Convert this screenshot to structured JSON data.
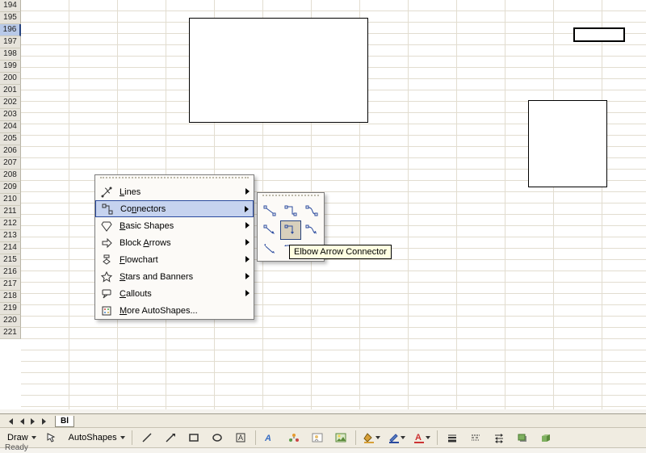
{
  "rows": [
    "194",
    "195",
    "196",
    "197",
    "198",
    "199",
    "200",
    "201",
    "202",
    "203",
    "204",
    "205",
    "206",
    "207",
    "208",
    "209",
    "210",
    "211",
    "212",
    "213",
    "214",
    "215",
    "216",
    "217",
    "218",
    "219",
    "220",
    "221"
  ],
  "selected_row": "196",
  "menu": {
    "items": [
      {
        "label": "Lines",
        "accel": "L",
        "icon": "lines-icon",
        "arrow": true
      },
      {
        "label": "Connectors",
        "accel": "N",
        "icon": "connectors-icon",
        "arrow": true,
        "highlight": true
      },
      {
        "label": "Basic Shapes",
        "accel": "B",
        "icon": "basic-shapes-icon",
        "arrow": true
      },
      {
        "label": "Block Arrows",
        "accel": "A",
        "icon": "block-arrows-icon",
        "arrow": true
      },
      {
        "label": "Flowchart",
        "accel": "F",
        "icon": "flowchart-icon",
        "arrow": true
      },
      {
        "label": "Stars and Banners",
        "accel": "S",
        "icon": "stars-banners-icon",
        "arrow": true
      },
      {
        "label": "Callouts",
        "accel": "C",
        "icon": "callouts-icon",
        "arrow": true
      },
      {
        "label": "More AutoShapes...",
        "accel": "M",
        "icon": "more-icon",
        "arrow": false
      }
    ]
  },
  "submenu": {
    "options": [
      "straight-connector",
      "elbow-connector",
      "curved-connector",
      "straight-arrow-connector",
      "elbow-arrow-connector",
      "curved-arrow-connector",
      "straight-double-arrow",
      "elbow-double-arrow",
      "curved-double-arrow"
    ],
    "selected_index": 4
  },
  "tooltip": "Elbow Arrow Connector",
  "tabs": {
    "active": "Bl"
  },
  "toolbar": {
    "draw_label": "Draw",
    "autoshapes_label": "AutoShapes",
    "buttons": [
      "select-arrow",
      "line",
      "arrow",
      "rectangle",
      "oval",
      "textbox",
      "insert-wordart",
      "insert-diagram",
      "insert-clipart",
      "insert-picture",
      "fill-color",
      "line-color",
      "font-color",
      "line-style",
      "dash-style",
      "arrow-style",
      "shadow",
      "3d"
    ]
  },
  "status": "Ready"
}
